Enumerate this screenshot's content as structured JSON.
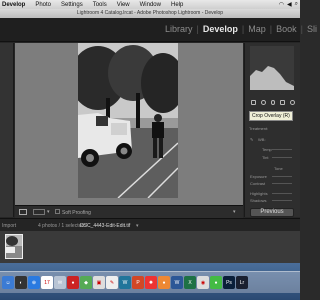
{
  "menubar": {
    "items": [
      "Develop",
      "Photo",
      "Settings",
      "Tools",
      "View",
      "Window",
      "Help"
    ]
  },
  "titlebar": {
    "title": "Lightroom 4 Catalog.lrcat - Adobe Photoshop Lightroom - Develop"
  },
  "modules": {
    "items": [
      "Library",
      "Develop",
      "Map",
      "Book",
      "Sli"
    ],
    "active": "Develop"
  },
  "right_panel": {
    "tooltip": "Crop Overlay (R)",
    "labels": [
      "Treatment:",
      "WB:",
      "Temp",
      "Tint",
      "Tone",
      "Exposure",
      "Contrast",
      "Highlights",
      "Shadows"
    ],
    "previous_label": "Previous"
  },
  "bottom_toolbar": {
    "soft_proofing": "Soft Proofing"
  },
  "filmstrip": {
    "source": "Import",
    "count": "4 photos / 1 selected /",
    "filename": "DSC_4443-Edit-Edit.tif"
  },
  "dock": {
    "icons": [
      {
        "name": "finder-icon",
        "color": "#3b7bd4",
        "glyph": "☺"
      },
      {
        "name": "dashboard-icon",
        "color": "#333",
        "glyph": "◐"
      },
      {
        "name": "safari-icon",
        "color": "#2a7ae0",
        "glyph": "⊕"
      },
      {
        "name": "calendar-icon",
        "color": "#fff",
        "glyph": "17"
      },
      {
        "name": "mail-icon",
        "color": "#b8c4d4",
        "glyph": "✉"
      },
      {
        "name": "app-icon-red",
        "color": "#c22",
        "glyph": "●"
      },
      {
        "name": "maps-icon",
        "color": "#5a5",
        "glyph": "◆"
      },
      {
        "name": "preview-icon",
        "color": "#ddd",
        "glyph": "▣"
      },
      {
        "name": "textedit-icon",
        "color": "#eee",
        "glyph": "✎"
      },
      {
        "name": "wordpress-icon",
        "color": "#21759b",
        "glyph": "W"
      },
      {
        "name": "powerpoint-icon",
        "color": "#d24726",
        "glyph": "P"
      },
      {
        "name": "app-icon-flame",
        "color": "#e33",
        "glyph": "✹"
      },
      {
        "name": "app-icon-orange",
        "color": "#e83",
        "glyph": "●"
      },
      {
        "name": "word-icon",
        "color": "#2b5797",
        "glyph": "W"
      },
      {
        "name": "excel-icon",
        "color": "#1e7145",
        "glyph": "X"
      },
      {
        "name": "chrome-icon",
        "color": "#ddd",
        "glyph": "◉"
      },
      {
        "name": "app-icon-green",
        "color": "#4b4",
        "glyph": "●"
      },
      {
        "name": "photoshop-icon",
        "color": "#0a1f3a",
        "glyph": "Ps"
      },
      {
        "name": "lightroom-icon",
        "color": "#1a2030",
        "glyph": "Lr"
      }
    ]
  }
}
